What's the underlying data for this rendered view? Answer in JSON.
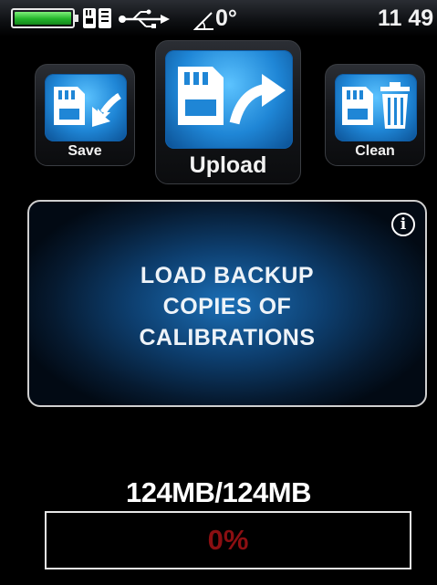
{
  "status_bar": {
    "battery_level": 1.0,
    "battery_color": "#2fbf35",
    "sd_icon": "sd-card-icon",
    "usb_icon": "usb-icon",
    "angle_icon": "angle-icon",
    "angle_value": "0°",
    "time": "11 49"
  },
  "actions": {
    "save": {
      "label": "Save",
      "icon": "sd-card-save-icon"
    },
    "upload": {
      "label": "Upload",
      "icon": "sd-card-upload-icon"
    },
    "clean": {
      "label": "Clean",
      "icon": "sd-card-trash-icon"
    }
  },
  "panel": {
    "info_icon": "info-icon",
    "info_glyph": "i",
    "message_lines": [
      "LOAD BACKUP",
      "COPIES OF",
      "CALIBRATIONS"
    ]
  },
  "storage": {
    "text": "124MB/124MB"
  },
  "progress": {
    "percent_text": "0%",
    "value": 0,
    "text_color": "#8b0f12"
  },
  "colors": {
    "accent_blue": "#1f86d6",
    "panel_border": "#cfcfcf"
  }
}
